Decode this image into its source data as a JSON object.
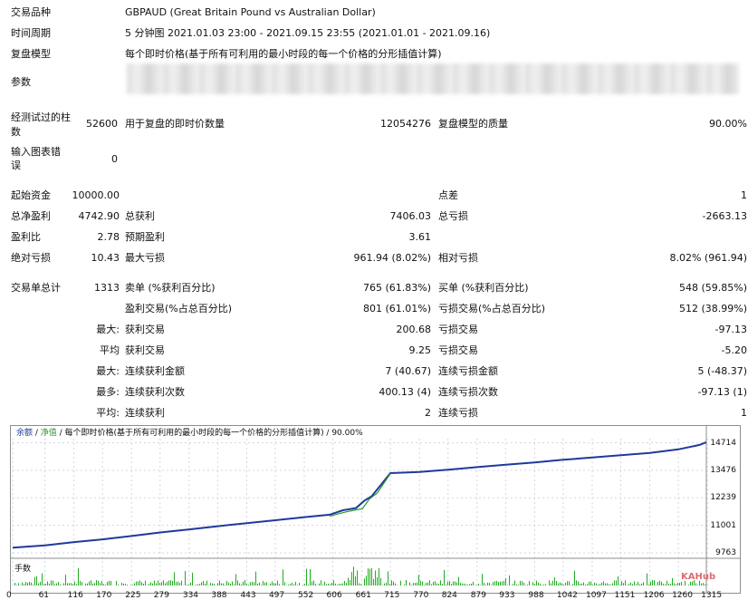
{
  "header": {
    "symbol_label": "交易品种",
    "symbol_value": "GBPAUD (Great Britain Pound vs Australian Dollar)",
    "period_label": "时间周期",
    "period_value": "5 分钟图 2021.01.03 23:00 - 2021.09.15 23:55 (2021.01.01 - 2021.09.16)",
    "model_label": "复盘模型",
    "model_value": "每个即时价格(基于所有可利用的最小时段的每一个价格的分形插值计算)",
    "params_label": "参数"
  },
  "test_info": {
    "bars_label": "经测试过的柱数",
    "bars_value": "52600",
    "ticks_label": "用于复盘的即时价数量",
    "ticks_value": "12054276",
    "quality_label": "复盘模型的质量",
    "quality_value": "90.00%",
    "errors_label": "输入图表错误",
    "errors_value": "0"
  },
  "results": {
    "initial_deposit_label": "起始资金",
    "initial_deposit_value": "10000.00",
    "spread_label": "点差",
    "spread_value": "1",
    "net_profit_label": "总净盈利",
    "net_profit_value": "4742.90",
    "gross_profit_label": "总获利",
    "gross_profit_value": "7406.03",
    "gross_loss_label": "总亏损",
    "gross_loss_value": "-2663.13",
    "profit_factor_label": "盈利比",
    "profit_factor_value": "2.78",
    "expected_payoff_label": "预期盈利",
    "expected_payoff_value": "3.61",
    "abs_drawdown_label": "绝对亏损",
    "abs_drawdown_value": "10.43",
    "max_drawdown_label": "最大亏损",
    "max_drawdown_value": "961.94 (8.02%)",
    "rel_drawdown_label": "相对亏损",
    "rel_drawdown_value": "8.02% (961.94)",
    "total_trades_label": "交易单总计",
    "total_trades_value": "1313",
    "short_label": "卖单 (%获利百分比)",
    "short_value": "765 (61.83%)",
    "long_label": "买单 (%获利百分比)",
    "long_value": "548 (59.85%)",
    "profit_trades_label": "盈利交易(%占总百分比)",
    "profit_trades_value": "801 (61.01%)",
    "loss_trades_label": "亏损交易(%占总百分比)",
    "loss_trades_value": "512 (38.99%)",
    "largest_prefix": "最大:",
    "largest_profit_label": "获利交易",
    "largest_profit_value": "200.68",
    "largest_loss_label": "亏损交易",
    "largest_loss_value": "-97.13",
    "average_prefix": "平均",
    "average_profit_label": "获利交易",
    "average_profit_value": "9.25",
    "average_loss_label": "亏损交易",
    "average_loss_value": "-5.20",
    "max_consec_prefix": "最大:",
    "max_consec_wins_label": "连续获利金额",
    "max_consec_wins_value": "7 (40.67)",
    "max_consec_losses_label": "连续亏损金额",
    "max_consec_losses_value": "5 (-48.37)",
    "maximal_prefix": "最多:",
    "maximal_consec_profit_label": "连续获利次数",
    "maximal_consec_profit_value": "400.13 (4)",
    "maximal_consec_loss_label": "连续亏损次数",
    "maximal_consec_loss_value": "-97.13 (1)",
    "avg_consec_prefix": "平均:",
    "avg_consec_wins_label": "连续获利",
    "avg_consec_wins_value": "2",
    "avg_consec_losses_label": "连续亏损",
    "avg_consec_losses_value": "1"
  },
  "chart_legend": {
    "balance": "余额",
    "sep1": " / ",
    "equity": "净值",
    "rest": " / 每个即时价格(基于所有可利用的最小时段的每一个价格的分形插值计算) / 90.00%"
  },
  "chart_volume_label": "手数",
  "watermark": "KAHub",
  "colors": {
    "balance_line": "#1f3a9a",
    "equity_line": "#2b9a2b",
    "grid": "#cfd8e3",
    "volume_bars": "#22aa22"
  },
  "chart_data": {
    "type": "line",
    "title": "",
    "ylabel": "",
    "xlabel": "",
    "ylim": [
      9763,
      14900
    ],
    "xlim": [
      0,
      1313
    ],
    "grid": true,
    "y_ticks": [
      "14714",
      "13476",
      "12239",
      "11001",
      "9763"
    ],
    "x_ticks": [
      "0",
      "61",
      "116",
      "170",
      "225",
      "279",
      "334",
      "388",
      "443",
      "497",
      "552",
      "606",
      "661",
      "715",
      "770",
      "824",
      "879",
      "933",
      "988",
      "1042",
      "1097",
      "1151",
      "1206",
      "1260",
      "1315"
    ],
    "series": [
      {
        "name": "余额",
        "points": [
          [
            0,
            10000
          ],
          [
            61,
            10100
          ],
          [
            116,
            10250
          ],
          [
            170,
            10370
          ],
          [
            225,
            10520
          ],
          [
            279,
            10680
          ],
          [
            334,
            10820
          ],
          [
            388,
            10960
          ],
          [
            443,
            11100
          ],
          [
            497,
            11230
          ],
          [
            552,
            11370
          ],
          [
            600,
            11480
          ],
          [
            625,
            11680
          ],
          [
            650,
            11780
          ],
          [
            665,
            12100
          ],
          [
            680,
            12320
          ],
          [
            715,
            13350
          ],
          [
            770,
            13400
          ],
          [
            824,
            13500
          ],
          [
            879,
            13620
          ],
          [
            933,
            13730
          ],
          [
            988,
            13830
          ],
          [
            1042,
            13950
          ],
          [
            1097,
            14050
          ],
          [
            1151,
            14160
          ],
          [
            1206,
            14260
          ],
          [
            1260,
            14420
          ],
          [
            1300,
            14620
          ],
          [
            1313,
            14742.9
          ]
        ]
      },
      {
        "name": "净值",
        "points": [
          [
            600,
            11420
          ],
          [
            630,
            11600
          ],
          [
            650,
            11700
          ],
          [
            662,
            11750
          ],
          [
            675,
            12180
          ],
          [
            690,
            12450
          ],
          [
            715,
            13330
          ]
        ]
      }
    ]
  }
}
